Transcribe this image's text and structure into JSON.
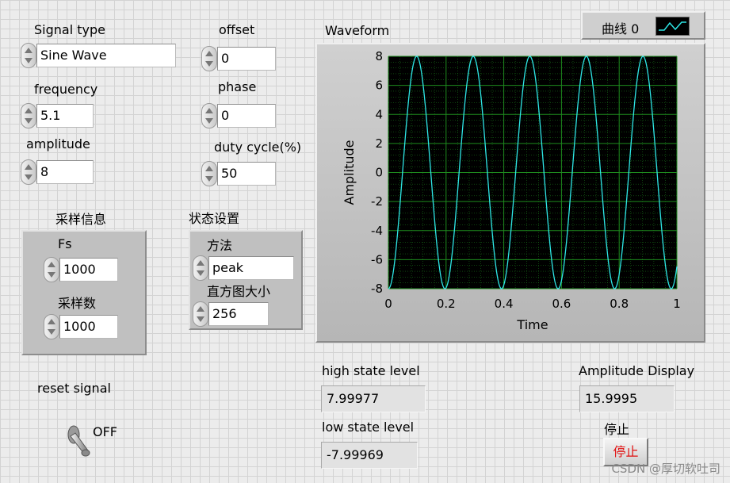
{
  "controls": {
    "signal_type": {
      "label": "Signal type",
      "value": "Sine Wave"
    },
    "frequency": {
      "label": "frequency",
      "value": "5.1"
    },
    "amplitude": {
      "label": "amplitude",
      "value": "8"
    },
    "offset": {
      "label": "offset",
      "value": "0"
    },
    "phase": {
      "label": "phase",
      "value": "0"
    },
    "duty_cycle": {
      "label": "duty cycle(%)",
      "value": "50"
    }
  },
  "sampling": {
    "title": "采样信息",
    "fs": {
      "label": "Fs",
      "value": "1000"
    },
    "samples": {
      "label": "采样数",
      "value": "1000"
    }
  },
  "state_settings": {
    "title": "状态设置",
    "method": {
      "label": "方法",
      "value": "peak"
    },
    "histogram": {
      "label": "直方图大小",
      "value": "256"
    }
  },
  "reset": {
    "label": "reset signal",
    "state": "OFF"
  },
  "indicators": {
    "high_state": {
      "label": "high state level",
      "value": "7.99977"
    },
    "low_state": {
      "label": "low state level",
      "value": "-7.99969"
    },
    "amplitude_display": {
      "label": "Amplitude Display",
      "value": "15.9995"
    }
  },
  "stop_button": {
    "caption": "停止",
    "label": "停止"
  },
  "legend": {
    "label": "曲线 0"
  },
  "watermark": "CSDN @厚切软吐司",
  "colors": {
    "plot_bg": "#000000",
    "grid": "#1e8a1e",
    "trace": "#2ee6e6",
    "stop_text": "#e01010"
  },
  "chart_data": {
    "type": "line",
    "title": "Waveform",
    "xlabel": "Time",
    "ylabel": "Amplitude",
    "xlim": [
      0,
      1
    ],
    "ylim": [
      -8,
      8
    ],
    "x_ticks": [
      "0",
      "0.2",
      "0.4",
      "0.6",
      "0.8",
      "1"
    ],
    "y_ticks": [
      "8",
      "6",
      "4",
      "2",
      "0",
      "-2",
      "-4",
      "-6",
      "-8"
    ],
    "grid": true,
    "series": [
      {
        "name": "曲线 0",
        "function": "sine",
        "amplitude": 8,
        "frequency": 5.1,
        "phase": 0,
        "offset": 0,
        "x_start": 0,
        "x_end": 1
      }
    ]
  }
}
